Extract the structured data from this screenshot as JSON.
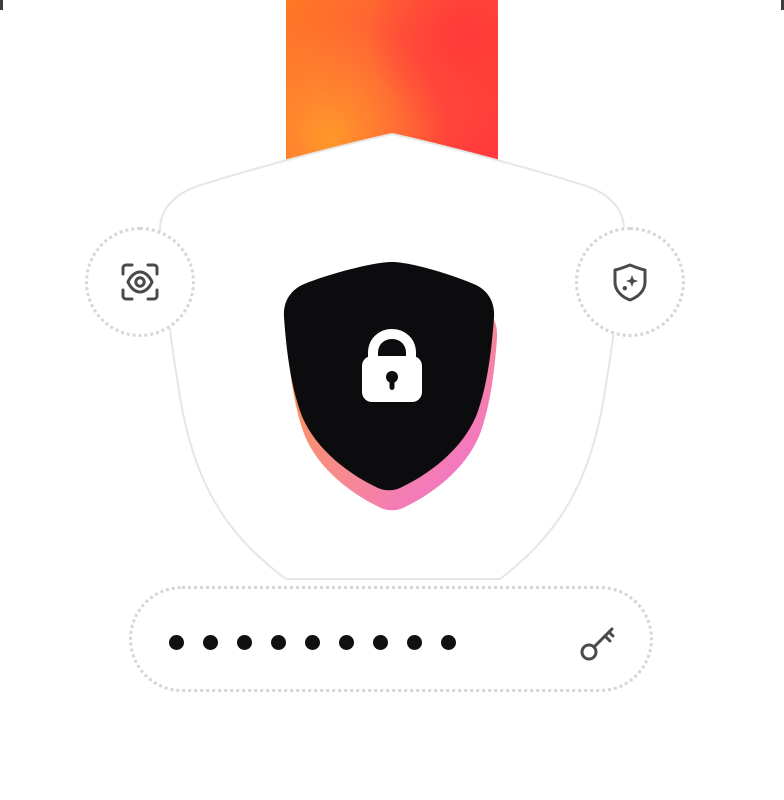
{
  "theme": {
    "gradient_orange": "#FF9A30",
    "gradient_red": "#FF3A3E",
    "shield_black": "#0C0C0E",
    "shield_shadow_orange": "#FF9340",
    "shield_shadow_pink": "#F06BE2",
    "outline_color": "#E6E6E6",
    "dotted_border_color": "#D6D6D6",
    "icon_color": "#4A4A4A",
    "password_dot_color": "#111111"
  },
  "icons": {
    "left": "eye-scan-icon",
    "center": "lock-icon",
    "right": "shield-sparkle-icon",
    "password": "key-icon"
  },
  "password_field": {
    "masked_dot_count": 9
  }
}
